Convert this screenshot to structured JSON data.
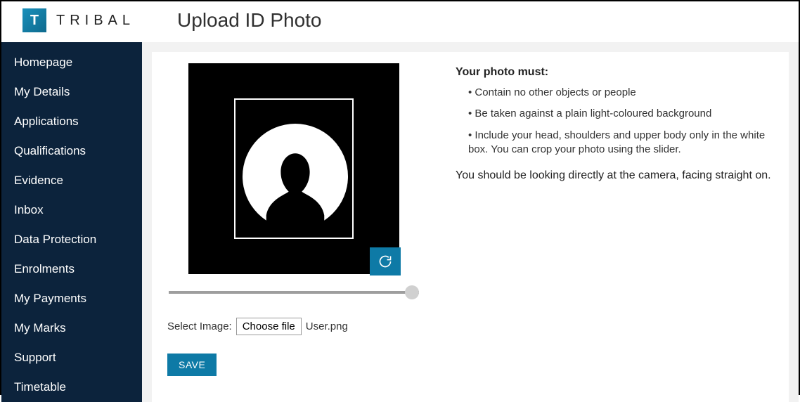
{
  "brand": {
    "logo_letter": "T",
    "name": "TRIBAL"
  },
  "page_title": "Upload ID Photo",
  "sidebar": {
    "items": [
      {
        "label": "Homepage"
      },
      {
        "label": "My Details"
      },
      {
        "label": "Applications"
      },
      {
        "label": "Qualifications"
      },
      {
        "label": "Evidence"
      },
      {
        "label": "Inbox"
      },
      {
        "label": "Data Protection"
      },
      {
        "label": "Enrolments"
      },
      {
        "label": "My Payments"
      },
      {
        "label": "My Marks"
      },
      {
        "label": "Support"
      },
      {
        "label": "Timetable"
      }
    ]
  },
  "upload": {
    "select_label": "Select Image:",
    "choose_label": "Choose file",
    "filename": "User.png",
    "save_label": "SAVE"
  },
  "requirements": {
    "heading": "Your photo must:",
    "bullets": [
      "Contain no other objects or people",
      "Be taken against a plain light-coloured background",
      "Include your head, shoulders and upper body only in the white box. You can crop your photo using the slider."
    ],
    "look_line": "You should be looking directly at the camera, facing straight on."
  },
  "colors": {
    "accent": "#0e7aa6",
    "sidebar": "#0c233c"
  }
}
